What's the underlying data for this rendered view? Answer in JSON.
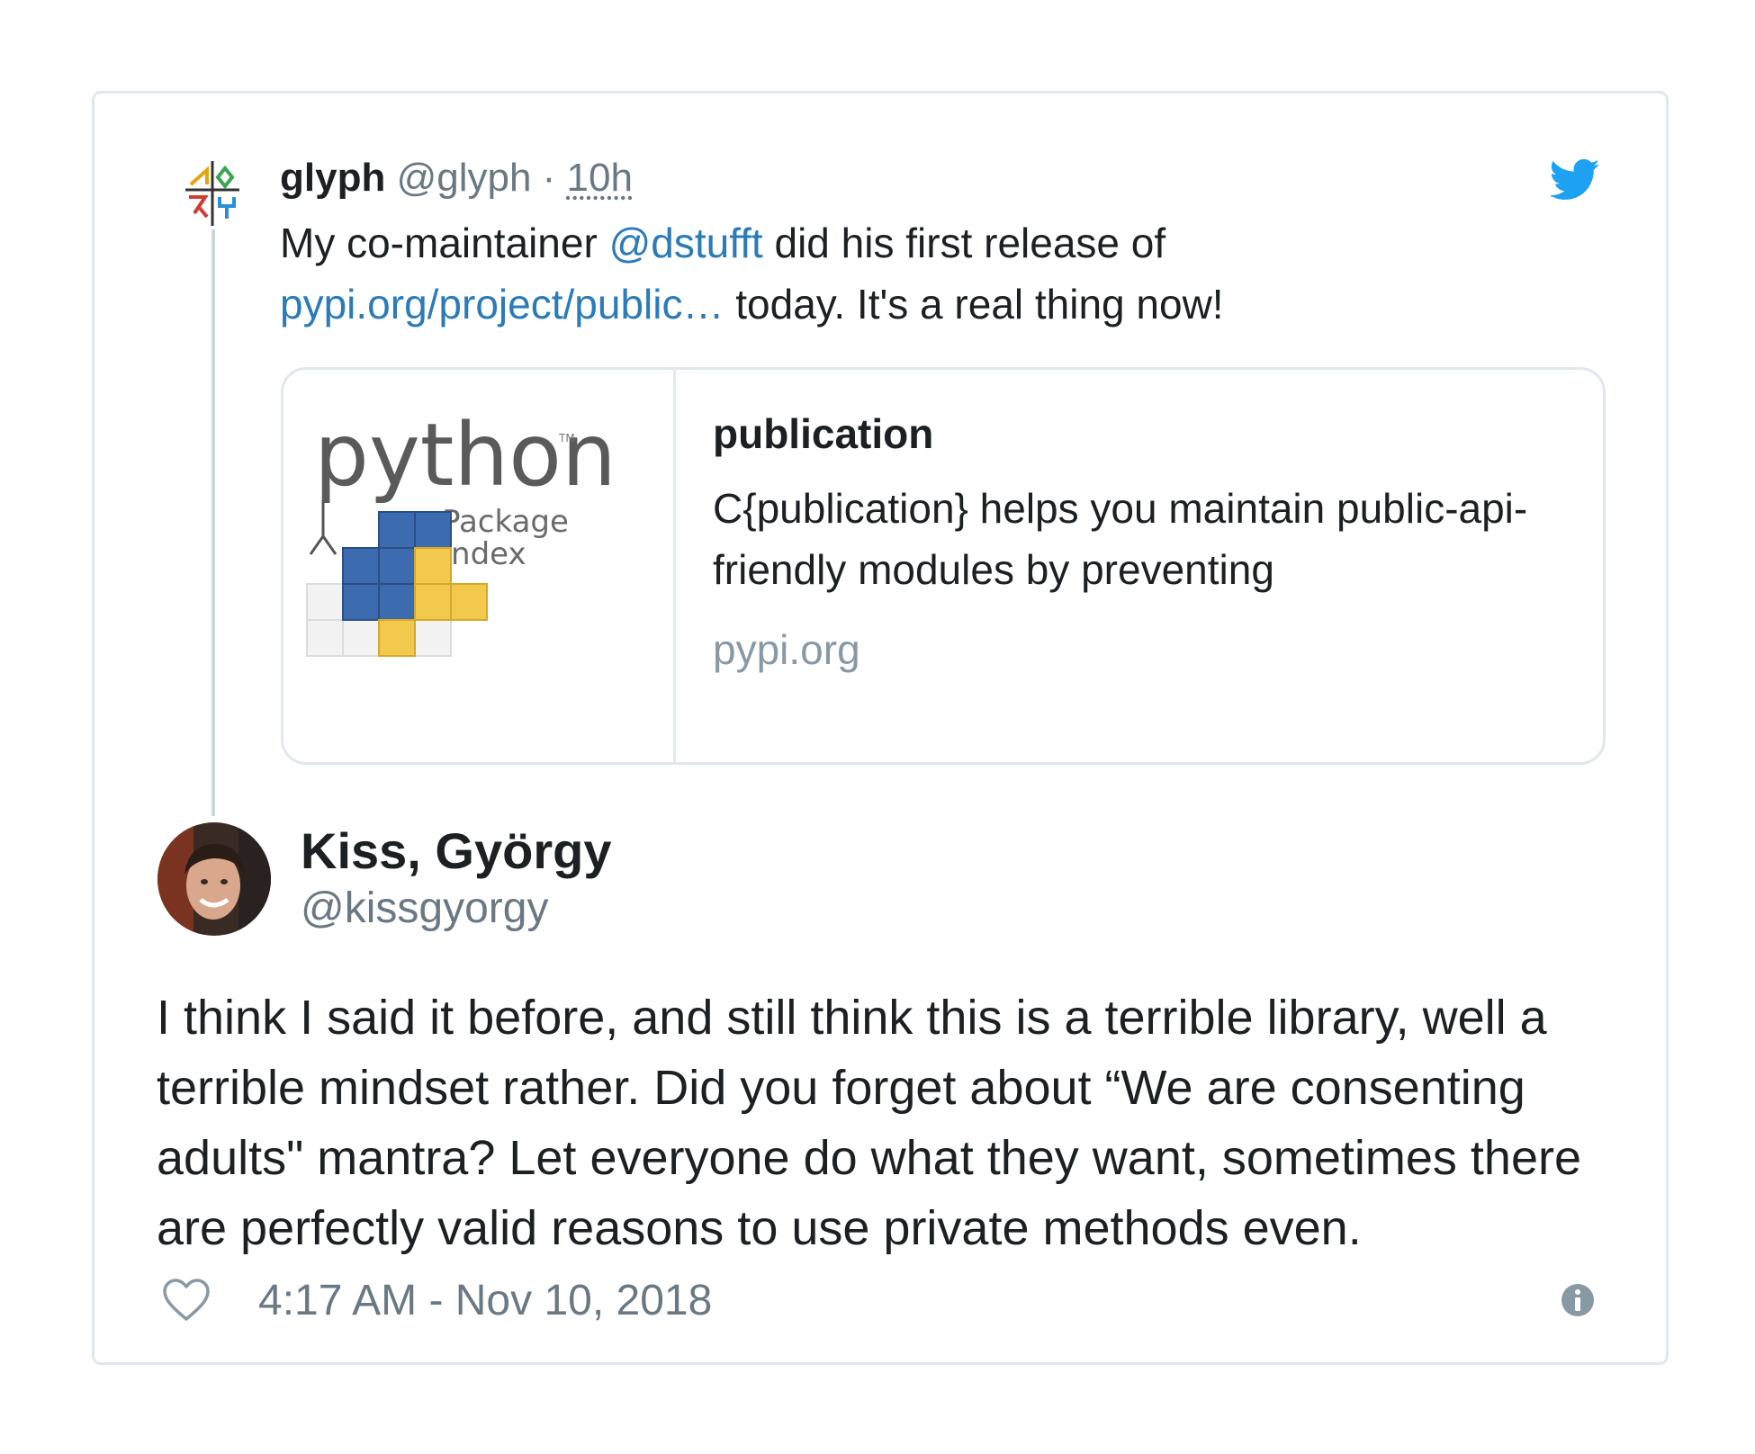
{
  "quoted_tweet": {
    "name": "glyph",
    "handle": "@glyph",
    "separator": "·",
    "time": "10h",
    "text_before_mention": "My co-maintainer ",
    "mention": "@dstufft",
    "text_after_mention": " did his first release of",
    "link": "pypi.org/project/public…",
    "text_end": " today. It's a real thing now!",
    "link_card": {
      "image_logo_text": "python",
      "image_sub_line1": "Package",
      "image_sub_line2": "Index",
      "image_tm": "TM",
      "title": "publication",
      "description": "C{publication} helps you maintain public-api-friendly modules by preventing",
      "domain": "pypi.org"
    }
  },
  "main_tweet": {
    "name": "Kiss, György",
    "handle": "@kissgyorgy",
    "text": "I think I said it before, and still think this is a terrible library, well a terrible mindset rather. Did you forget about “We are consenting adults\" mantra? Let everyone do what they want, sometimes there are perfectly valid reasons to use private methods even.",
    "timestamp": "4:17 AM - Nov 10, 2018"
  },
  "icons": {
    "twitter": "twitter-bird-icon",
    "like": "heart-icon",
    "info": "info-icon"
  },
  "colors": {
    "link": "#2b7bb9",
    "twitter_blue": "#1da1f2",
    "muted": "#697882",
    "border": "#e1e8ed"
  }
}
